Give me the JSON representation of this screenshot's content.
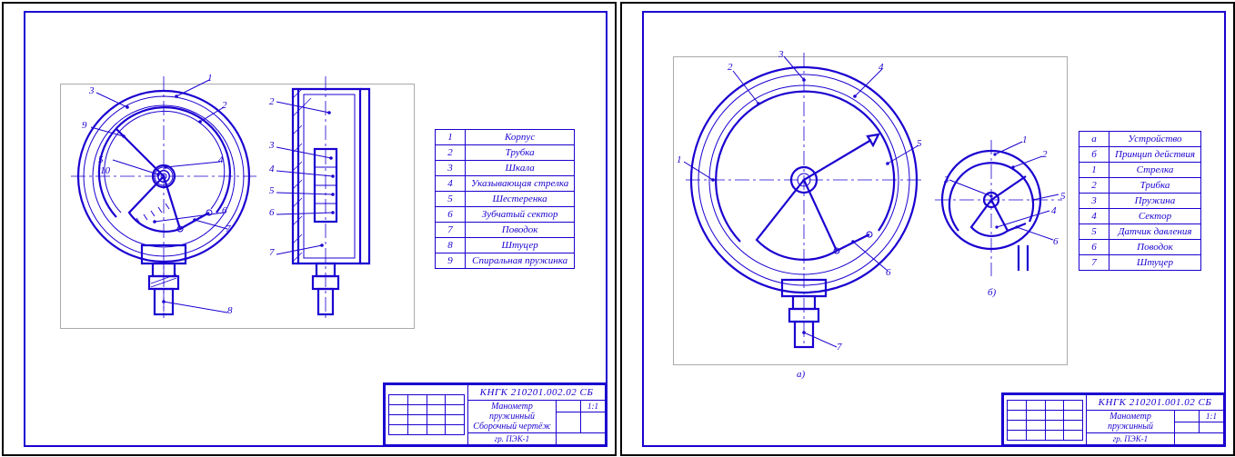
{
  "sheets": [
    {
      "titleblock": {
        "code": "КНГК 210201.002.02 СБ",
        "line1": "Манометр пружинный",
        "line2": "Сборочный чертёж",
        "group": "гр. ПЭК-1",
        "scale": "1:1"
      },
      "fig_labels": [
        "8"
      ],
      "parts": [
        {
          "n": "1",
          "name": "Корпус"
        },
        {
          "n": "2",
          "name": "Трубка"
        },
        {
          "n": "3",
          "name": "Шкала"
        },
        {
          "n": "4",
          "name": "Указывающая стрелка"
        },
        {
          "n": "5",
          "name": "Шестеренка"
        },
        {
          "n": "6",
          "name": "Зубчатый сектор"
        },
        {
          "n": "7",
          "name": "Поводок"
        },
        {
          "n": "8",
          "name": "Штуцер"
        },
        {
          "n": "9",
          "name": "Спиральная пружинка"
        }
      ],
      "callouts_front": [
        "1",
        "2",
        "3",
        "4",
        "5",
        "6",
        "7",
        "9",
        "10"
      ],
      "callouts_side": [
        "2",
        "3",
        "4",
        "5",
        "6",
        "7"
      ]
    },
    {
      "titleblock": {
        "code": "КНГК 210201.001.02 СБ",
        "line1": "Манометр пружинный",
        "line2": "",
        "group": "гр. ПЭК-1",
        "scale": "1:1"
      },
      "fig_labels": [
        "а)",
        "б)"
      ],
      "parts": [
        {
          "n": "а",
          "name": "Устройство"
        },
        {
          "n": "б",
          "name": "Принцип действия"
        },
        {
          "n": "1",
          "name": "Стрелка"
        },
        {
          "n": "2",
          "name": "Трибка"
        },
        {
          "n": "3",
          "name": "Пружина"
        },
        {
          "n": "4",
          "name": "Сектор"
        },
        {
          "n": "5",
          "name": "Датчик давления"
        },
        {
          "n": "6",
          "name": "Поводок"
        },
        {
          "n": "7",
          "name": "Штуцер"
        }
      ],
      "callouts_front": [
        "1",
        "2",
        "3",
        "4",
        "5",
        "6",
        "7"
      ],
      "callouts_side": [
        "1",
        "2",
        "3",
        "4",
        "5",
        "6"
      ]
    }
  ]
}
